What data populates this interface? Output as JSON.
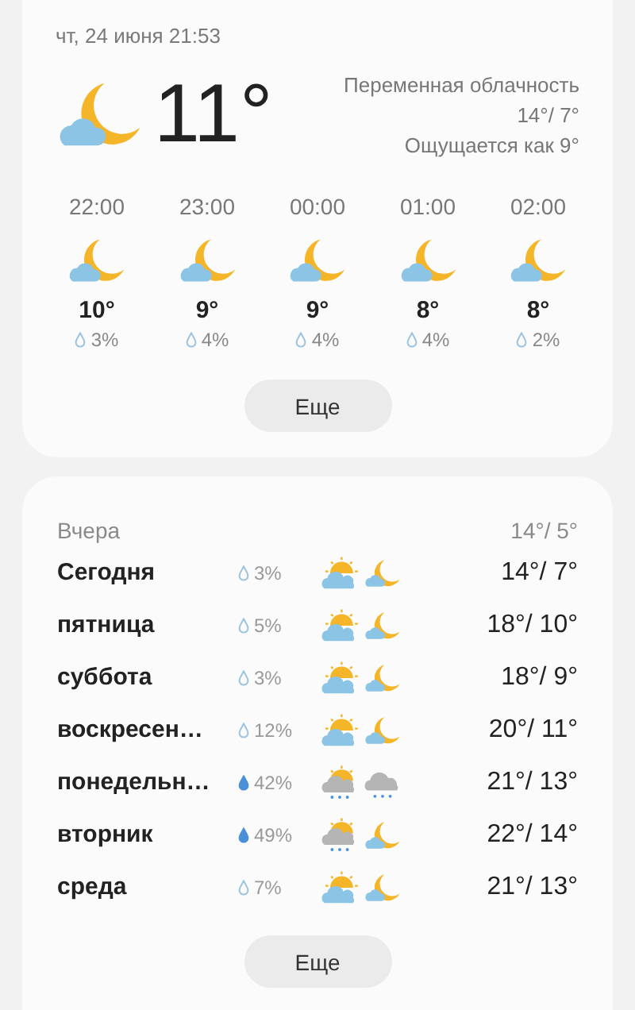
{
  "current": {
    "datetime": "чт, 24 июня 21:53",
    "weather": {
      "kind": "night_cloud"
    },
    "temperature": "11°",
    "condition": "Переменная облачность",
    "high_low": "14°/ 7°",
    "feels_like": "Ощущается как 9°"
  },
  "hourly": [
    {
      "time": "22:00",
      "weather": {
        "kind": "night_cloud"
      },
      "temperature": "10°",
      "precipitation": "3%"
    },
    {
      "time": "23:00",
      "weather": {
        "kind": "night_cloud"
      },
      "temperature": "9°",
      "precipitation": "4%"
    },
    {
      "time": "00:00",
      "weather": {
        "kind": "night_cloud"
      },
      "temperature": "9°",
      "precipitation": "4%"
    },
    {
      "time": "01:00",
      "weather": {
        "kind": "night_cloud"
      },
      "temperature": "8°",
      "precipitation": "4%"
    },
    {
      "time": "02:00",
      "weather": {
        "kind": "night_cloud"
      },
      "temperature": "8°",
      "precipitation": "2%"
    }
  ],
  "hourly_more_button": "Еще",
  "yesterday": {
    "label": "Вчера",
    "high_low": "14°/ 5°"
  },
  "daily": [
    {
      "day": "Сегодня",
      "precipitation": "3%",
      "heavy": false,
      "weather": [
        {
          "kind": "day_cloud"
        },
        {
          "kind": "night_cloud"
        }
      ],
      "high_low": "14°/ 7°"
    },
    {
      "day": "пятница",
      "precipitation": "5%",
      "heavy": false,
      "weather": [
        {
          "kind": "day_cloud"
        },
        {
          "kind": "night_cloud"
        }
      ],
      "high_low": "18°/ 10°"
    },
    {
      "day": "суббота",
      "precipitation": "3%",
      "heavy": false,
      "weather": [
        {
          "kind": "day_cloud"
        },
        {
          "kind": "night_cloud"
        }
      ],
      "high_low": "18°/ 9°"
    },
    {
      "day": "воскресен…",
      "precipitation": "12%",
      "heavy": false,
      "weather": [
        {
          "kind": "day_cloud"
        },
        {
          "kind": "night_cloud"
        }
      ],
      "high_low": "20°/ 11°"
    },
    {
      "day": "понедельн…",
      "precipitation": "42%",
      "heavy": true,
      "weather": [
        {
          "kind": "day_rain"
        },
        {
          "kind": "rain"
        }
      ],
      "high_low": "21°/ 13°"
    },
    {
      "day": "вторник",
      "precipitation": "49%",
      "heavy": true,
      "weather": [
        {
          "kind": "day_rain"
        },
        {
          "kind": "night_cloud"
        }
      ],
      "high_low": "22°/ 14°"
    },
    {
      "day": "среда",
      "precipitation": "7%",
      "heavy": false,
      "weather": [
        {
          "kind": "day_cloud"
        },
        {
          "kind": "night_cloud"
        }
      ],
      "high_low": "21°/ 13°"
    }
  ],
  "daily_more_button": "Еще"
}
